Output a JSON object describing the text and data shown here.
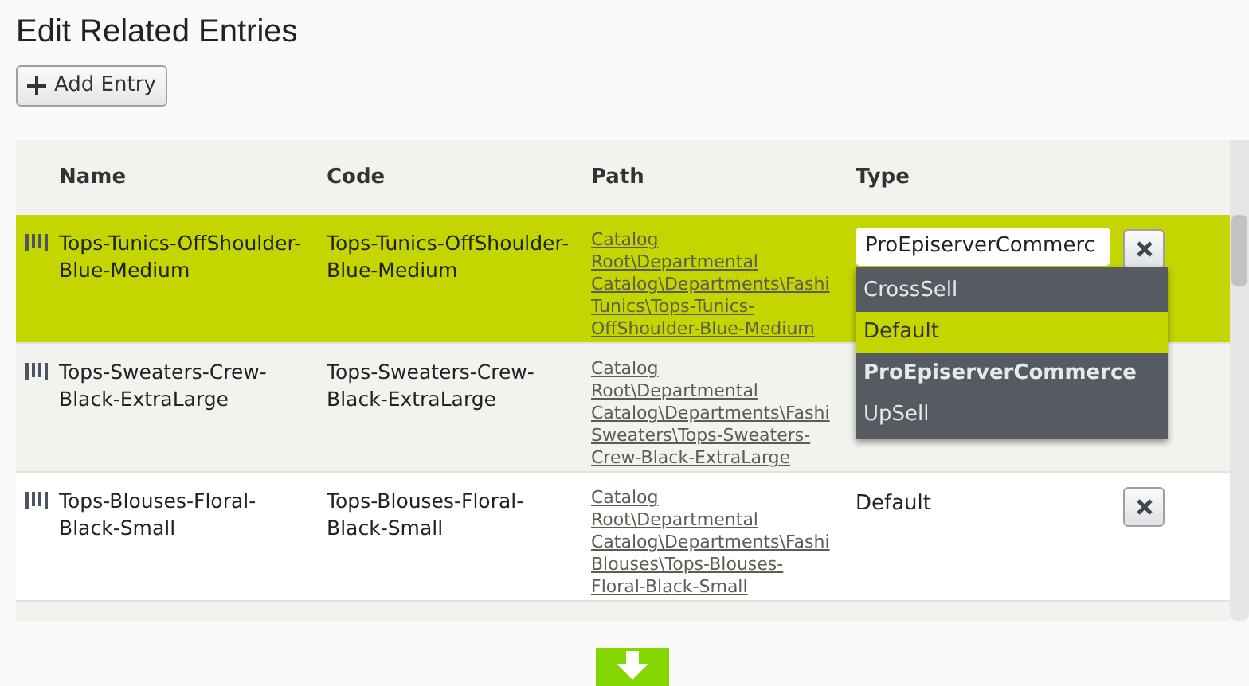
{
  "title": "Edit Related Entries",
  "add_button": {
    "label": "Add Entry"
  },
  "table": {
    "columns": [
      "Name",
      "Code",
      "Path",
      "Type"
    ],
    "rows": [
      {
        "selected": true,
        "name": "Tops-Tunics-OffShoulder-Blue-Medium",
        "code": "Tops-Tunics-OffShoulder-Blue-Medium",
        "path": [
          "Catalog",
          "Root\\Departmental",
          "Catalog\\Departments\\Fashi",
          "Tunics\\Tops-Tunics-",
          "OffShoulder-Blue-Medium"
        ],
        "type": "ProEpiserverCommerc",
        "editing": true,
        "options": [
          {
            "label": "CrossSell",
            "selected": false,
            "current": false
          },
          {
            "label": "Default",
            "selected": true,
            "current": false
          },
          {
            "label": "ProEpiserverCommerce",
            "selected": false,
            "current": true
          },
          {
            "label": "UpSell",
            "selected": false,
            "current": false
          }
        ]
      },
      {
        "selected": false,
        "name": "Tops-Sweaters-Crew-Black-ExtraLarge",
        "code": "Tops-Sweaters-Crew-Black-ExtraLarge",
        "path": [
          "Catalog",
          "Root\\Departmental",
          "Catalog\\Departments\\Fashi",
          "Sweaters\\Tops-Sweaters-",
          "Crew-Black-ExtraLarge"
        ],
        "editing": false
      },
      {
        "selected": false,
        "name": "Tops-Blouses-Floral-Black-Small",
        "code": "Tops-Blouses-Floral-Black-Small",
        "path": [
          "Catalog",
          "Root\\Departmental",
          "Catalog\\Departments\\Fashi",
          "Blouses\\Tops-Blouses-",
          "Floral-Black-Small"
        ],
        "type": "Default",
        "editing": false
      }
    ]
  }
}
